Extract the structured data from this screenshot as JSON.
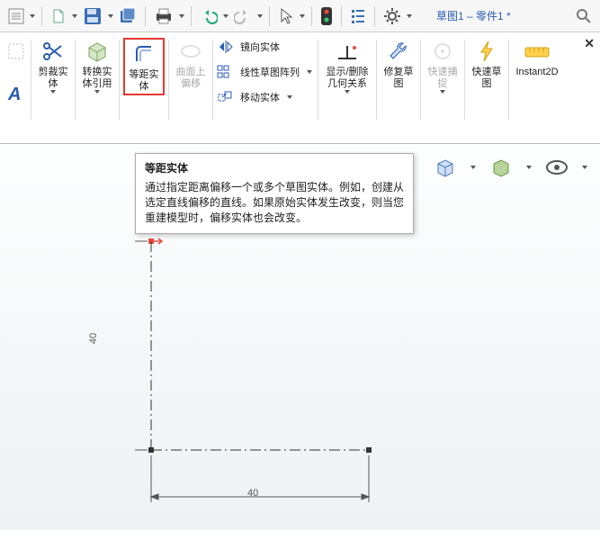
{
  "app": {
    "doc_title": "草图1 – 零件1 *"
  },
  "qa": {
    "search_hint": "搜索",
    "items": [
      "new",
      "open",
      "save",
      "saveall",
      "print",
      "undo",
      "redo",
      "select",
      "rebuild",
      "options",
      "settings"
    ]
  },
  "ribbon": {
    "left_icon1": "sketch-fillet",
    "left_icon2": "text-A",
    "groups": {
      "trim": {
        "label": "剪裁实体"
      },
      "convert": {
        "label": "转换实体引用"
      },
      "offset": {
        "label": "等距实体"
      },
      "surface": {
        "label": "曲面上偏移"
      },
      "mirror": {
        "label": "镜向实体"
      },
      "pattern": {
        "label": "线性草图阵列"
      },
      "move": {
        "label": "移动实体"
      },
      "relations": {
        "label": "显示/删除几何关系"
      },
      "repair": {
        "label": "修复草图"
      },
      "snap": {
        "label": "快速捕捉"
      },
      "quick": {
        "label": "快速草图"
      },
      "instant": {
        "label": "Instant2D"
      }
    }
  },
  "tooltip": {
    "title": "等距实体",
    "body": "通过指定距离偏移一个或多个草图实体。例如，创建从选定直线偏移的直线。如果原始实体发生改变，则当您重建模型时，偏移实体也会改变。"
  },
  "sketch": {
    "dim_v": "40",
    "dim_h": "40"
  }
}
